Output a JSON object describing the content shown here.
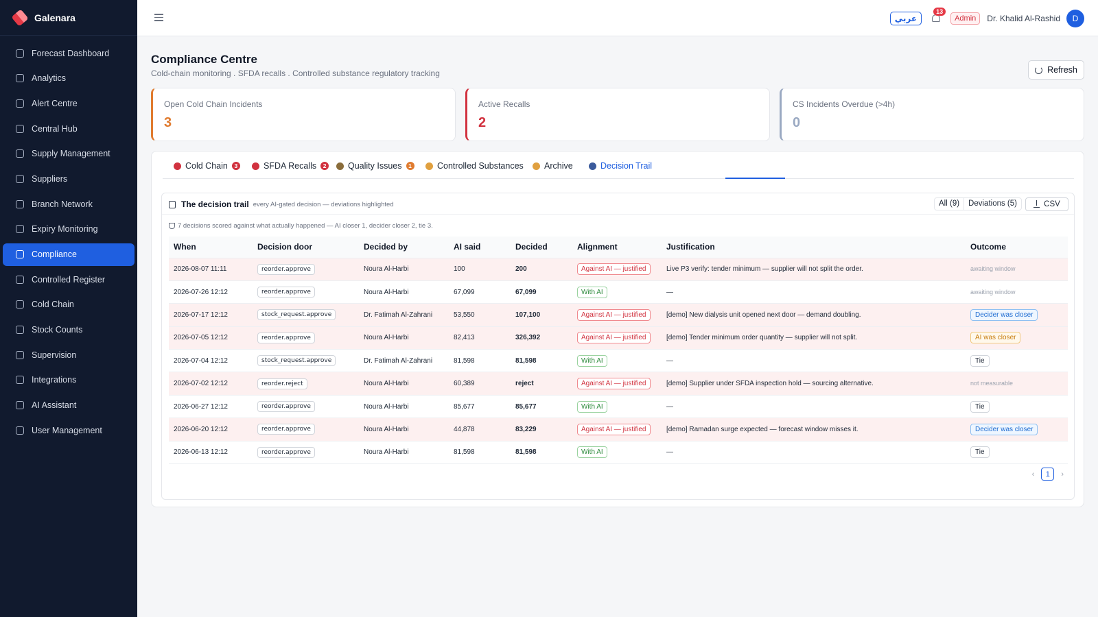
{
  "app": {
    "name": "Galenara"
  },
  "sidebar": {
    "items": [
      {
        "label": "Forecast Dashboard",
        "icon": "dashboard-icon",
        "active": false
      },
      {
        "label": "Analytics",
        "icon": "chart-icon",
        "active": false
      },
      {
        "label": "Alert Centre",
        "icon": "bell-icon",
        "active": false
      },
      {
        "label": "Central Hub",
        "icon": "building-icon",
        "active": false
      },
      {
        "label": "Supply Management",
        "icon": "cart-icon",
        "active": false
      },
      {
        "label": "Suppliers",
        "icon": "truck-icon",
        "active": false
      },
      {
        "label": "Branch Network",
        "icon": "network-icon",
        "active": false
      },
      {
        "label": "Expiry Monitoring",
        "icon": "clock-icon",
        "active": false
      },
      {
        "label": "Compliance",
        "icon": "clipboard-icon",
        "active": true
      },
      {
        "label": "Controlled Register",
        "icon": "shield-icon",
        "active": false
      },
      {
        "label": "Cold Chain",
        "icon": "thermometer-icon",
        "active": false
      },
      {
        "label": "Stock Counts",
        "icon": "checklist-icon",
        "active": false
      },
      {
        "label": "Supervision",
        "icon": "monitor-icon",
        "active": false
      },
      {
        "label": "Integrations",
        "icon": "plug-icon",
        "active": false
      },
      {
        "label": "AI Assistant",
        "icon": "robot-icon",
        "active": false
      },
      {
        "label": "User Management",
        "icon": "users-icon",
        "active": false
      }
    ]
  },
  "topbar": {
    "lang_label": "عربي",
    "notification_count": "13",
    "role": "Admin",
    "user_name": "Dr. Khalid Al-Rashid",
    "avatar_initial": "D"
  },
  "header": {
    "title": "Compliance Centre",
    "subtitle": "Cold-chain monitoring . SFDA recalls . Controlled substance regulatory tracking",
    "refresh_label": "Refresh"
  },
  "stats": [
    {
      "label": "Open Cold Chain Incidents",
      "value": "3",
      "color": "#e07b2f"
    },
    {
      "label": "Active Recalls",
      "value": "2",
      "color": "#d1323f"
    },
    {
      "label": "CS Incidents Overdue (>4h)",
      "value": "0",
      "color": "#9aa9c2"
    }
  ],
  "tabs": [
    {
      "label": "Cold Chain",
      "count": "3",
      "count_color": "#d1323f",
      "icon": "thermometer-icon",
      "icon_color": "#d1323f"
    },
    {
      "label": "SFDA Recalls",
      "count": "2",
      "count_color": "#d1323f",
      "icon": "recall-icon",
      "icon_color": "#d1323f"
    },
    {
      "label": "Quality Issues",
      "count": "1",
      "count_color": "#e07b2f",
      "icon": "pen-icon",
      "icon_color": "#8a6d3b"
    },
    {
      "label": "Controlled Substances",
      "count": "",
      "icon": "lock-icon",
      "icon_color": "#e0a03f"
    },
    {
      "label": "Archive",
      "count": "",
      "icon": "folder-icon",
      "icon_color": "#e0a03f"
    },
    {
      "label": "Decision Trail",
      "count": "",
      "icon": "robot-icon",
      "icon_color": "#3b5b9c",
      "active": true
    }
  ],
  "trail": {
    "title": "The decision trail",
    "subtitle": "every AI-gated decision — deviations highlighted",
    "filter_all": "All (9)",
    "filter_dev": "Deviations (5)",
    "csv_label": "CSV",
    "summary": "7 decisions scored against what actually happened — AI closer 1, decider closer 2, tie 3.",
    "columns": [
      "When",
      "Decision door",
      "Decided by",
      "AI said",
      "Decided",
      "Alignment",
      "Justification",
      "Outcome"
    ],
    "rows": [
      {
        "when": "2026-08-07 11:11",
        "door": "reorder.approve",
        "by": "Noura Al-Harbi",
        "ai": "100",
        "decided": "200",
        "align": "Against AI — justified",
        "align_type": "against",
        "just": "Live P3 verify: tender minimum — supplier will not split the order.",
        "outcome": "awaiting window",
        "outcome_type": "muted"
      },
      {
        "when": "2026-07-26 12:12",
        "door": "reorder.approve",
        "by": "Noura Al-Harbi",
        "ai": "67,099",
        "decided": "67,099",
        "align": "With AI",
        "align_type": "with",
        "just": "—",
        "outcome": "awaiting window",
        "outcome_type": "muted"
      },
      {
        "when": "2026-07-17 12:12",
        "door": "stock_request.approve",
        "by": "Dr. Fatimah Al-Zahrani",
        "ai": "53,550",
        "decided": "107,100",
        "align": "Against AI — justified",
        "align_type": "against",
        "just": "[demo] New dialysis unit opened next door — demand doubling.",
        "outcome": "Decider was closer",
        "outcome_type": "decider"
      },
      {
        "when": "2026-07-05 12:12",
        "door": "reorder.approve",
        "by": "Noura Al-Harbi",
        "ai": "82,413",
        "decided": "326,392",
        "align": "Against AI — justified",
        "align_type": "against",
        "just": "[demo] Tender minimum order quantity — supplier will not split.",
        "outcome": "AI was closer",
        "outcome_type": "ai"
      },
      {
        "when": "2026-07-04 12:12",
        "door": "stock_request.approve",
        "by": "Dr. Fatimah Al-Zahrani",
        "ai": "81,598",
        "decided": "81,598",
        "align": "With AI",
        "align_type": "with",
        "just": "—",
        "outcome": "Tie",
        "outcome_type": "tie"
      },
      {
        "when": "2026-07-02 12:12",
        "door": "reorder.reject",
        "by": "Noura Al-Harbi",
        "ai": "60,389",
        "decided": "reject",
        "align": "Against AI — justified",
        "align_type": "against",
        "just": "[demo] Supplier under SFDA inspection hold — sourcing alternative.",
        "outcome": "not measurable",
        "outcome_type": "muted"
      },
      {
        "when": "2026-06-27 12:12",
        "door": "reorder.approve",
        "by": "Noura Al-Harbi",
        "ai": "85,677",
        "decided": "85,677",
        "align": "With AI",
        "align_type": "with",
        "just": "—",
        "outcome": "Tie",
        "outcome_type": "tie"
      },
      {
        "when": "2026-06-20 12:12",
        "door": "reorder.approve",
        "by": "Noura Al-Harbi",
        "ai": "44,878",
        "decided": "83,229",
        "align": "Against AI — justified",
        "align_type": "against",
        "just": "[demo] Ramadan surge expected — forecast window misses it.",
        "outcome": "Decider was closer",
        "outcome_type": "decider"
      },
      {
        "when": "2026-06-13 12:12",
        "door": "reorder.approve",
        "by": "Noura Al-Harbi",
        "ai": "81,598",
        "decided": "81,598",
        "align": "With AI",
        "align_type": "with",
        "just": "—",
        "outcome": "Tie",
        "outcome_type": "tie"
      }
    ],
    "page": "1",
    "prev_label": "‹",
    "next_label": "›"
  }
}
